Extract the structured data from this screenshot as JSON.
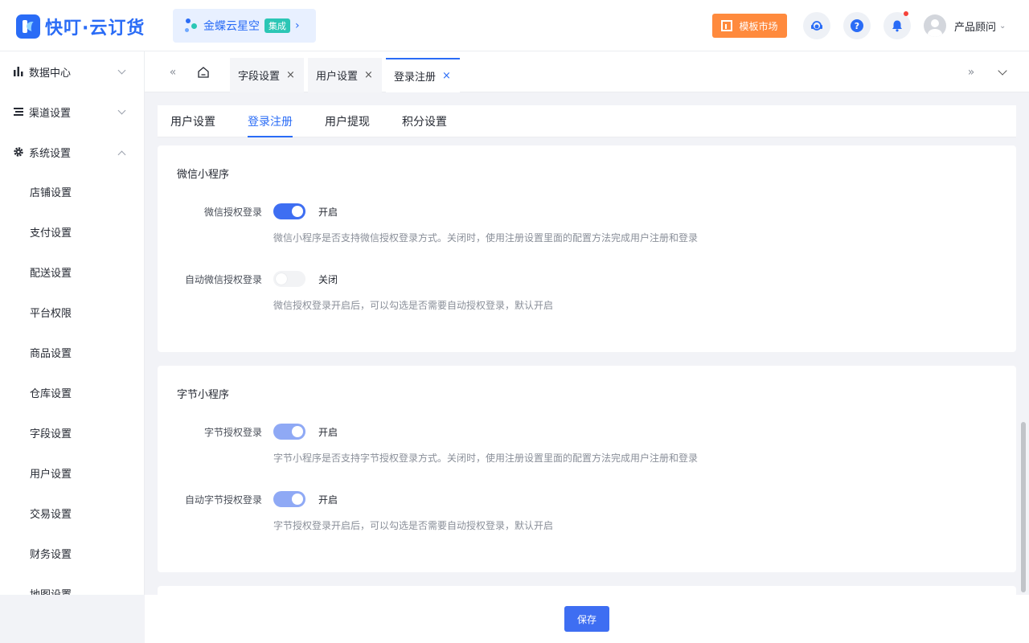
{
  "header": {
    "app_name": "快叮·云订货",
    "brand": {
      "name": "金蝶云星空",
      "tag": "集成",
      "arrow": "›"
    },
    "market_button": "模板市场",
    "user_name": "产品顾问",
    "user_caret": "⌄"
  },
  "sidebar": {
    "groups": [
      {
        "label": "数据中心",
        "icon": "bar-chart-icon",
        "expanded": false
      },
      {
        "label": "渠道设置",
        "icon": "list-icon",
        "expanded": false
      },
      {
        "label": "系统设置",
        "icon": "gear-icon",
        "expanded": true
      }
    ],
    "items": [
      "店铺设置",
      "支付设置",
      "配送设置",
      "平台权限",
      "商品设置",
      "仓库设置",
      "字段设置",
      "用户设置",
      "交易设置",
      "财务设置",
      "地图设置"
    ]
  },
  "tabbar": {
    "collapse_icon": "«",
    "expand_icon": "»",
    "tabs": [
      {
        "label": "字段设置",
        "active": false
      },
      {
        "label": "用户设置",
        "active": false
      },
      {
        "label": "登录注册",
        "active": true
      }
    ],
    "close_glyph": "×"
  },
  "subtabs": [
    "用户设置",
    "登录注册",
    "用户提现",
    "积分设置"
  ],
  "sections": {
    "wechat": {
      "title": "微信小程序",
      "rows": [
        {
          "label": "微信授权登录",
          "state": "开启",
          "hint": "微信小程序是否支持微信授权登录方式。关闭时，使用注册设置里面的配置方法完成用户注册和登录"
        },
        {
          "label": "自动微信授权登录",
          "state": "关闭",
          "hint": "微信授权登录开启后，可以勾选是否需要自动授权登录，默认开启"
        }
      ]
    },
    "bytedance": {
      "title": "字节小程序",
      "rows": [
        {
          "label": "字节授权登录",
          "state": "开启",
          "hint": "字节小程序是否支持字节授权登录方式。关闭时，使用注册设置里面的配置方法完成用户注册和登录"
        },
        {
          "label": "自动字节授权登录",
          "state": "开启",
          "hint": "字节授权登录开启后，可以勾选是否需要自动授权登录，默认开启"
        }
      ]
    }
  },
  "footer": {
    "save_label": "保存"
  },
  "colors": {
    "primary": "#3e6ef2",
    "market": "#ff8a3d",
    "tag": "#2bc6b5"
  }
}
